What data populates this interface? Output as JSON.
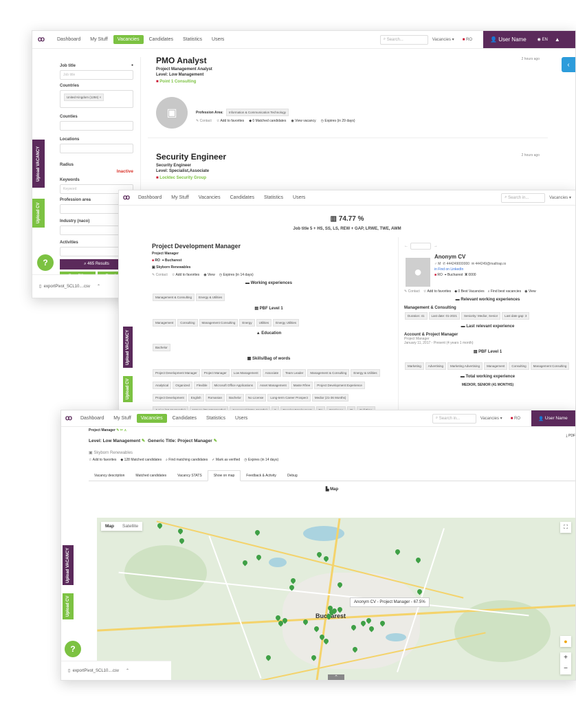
{
  "win1": {
    "nav": {
      "items": [
        "Dashboard",
        "My Stuff",
        "Vacancies",
        "Candidates",
        "Statistics",
        "Users"
      ],
      "active": "Vacancies",
      "search_placeholder": "Search...",
      "dropdown": "Vacancies",
      "lang_flag_label": "RO",
      "user": "User Name",
      "lang": "EN"
    },
    "filters": {
      "job_title_label": "Job title",
      "job_title_placeholder": "Job title",
      "countries_label": "Countries",
      "country_tag": "United Kingdom (1284)",
      "counties_label": "Counties",
      "locations_label": "Locations",
      "radius_label": "Radius",
      "radius_status": "Inactive",
      "keywords_label": "Keywords",
      "keywords_placeholder": "Keyword",
      "profession_label": "Profession area",
      "industry_label": "Industry (naco)",
      "activities_label": "Activities",
      "results_button": "465 Results",
      "save_filter": "Save Filter",
      "clear": "Deselect all"
    },
    "jobs": [
      {
        "title": "PMO Analyst",
        "subtitle": "Project Management Analyst",
        "level": "Level: Low Management",
        "company": "Point 1 Consulting",
        "time": "2 hours ago",
        "profession_label": "Profession Area:",
        "profession_value": "Information & Communication Technology",
        "actions": [
          "Contact",
          "Add to favorites",
          "0 Matched candidates",
          "View vacancy",
          "Expires (in 29 days)"
        ]
      },
      {
        "title": "Security Engineer",
        "subtitle": "Security Engineer",
        "level": "Level: Specialist,Associate",
        "company": "Locktec Security Group",
        "time": "2 hours ago"
      }
    ],
    "download": "exportPivot_SCL10....csv",
    "upload_vacancy": "Upload VACANCY",
    "upload_cv": "Upload CV"
  },
  "win2": {
    "nav": {
      "items": [
        "Dashboard",
        "My Stuff",
        "Vacancies",
        "Candidates",
        "Statistics",
        "Users"
      ],
      "search_placeholder": "Search in...",
      "dropdown": "Vacancies"
    },
    "score": "74.77 %",
    "score_subtitle": "Job title 5 + HS, SS, LS, REW + GAP, LRWE, TWE, AWM",
    "job": {
      "title": "Project Development Manager",
      "subtitle": "Project Manager",
      "country": "RO",
      "city": "Bucharest",
      "company": "Skyborn Renewables",
      "actions": [
        "Contact",
        "Add to favorites",
        "View",
        "Expires (in 14 days)"
      ],
      "working_exp_h": "Working experiences",
      "working_chips": [
        "Management & Consulting",
        "Energy & Utilities"
      ],
      "pbf_h": "PBF Level 1",
      "pbf_chips": [
        "Management",
        "Consulting",
        "Management Consulting",
        "Energy",
        "Utilities",
        "Energy Utilities"
      ],
      "education_h": "Education",
      "education_chips": [
        "Bachelor"
      ],
      "skills_h": "Skills/Bag of words",
      "skills_chips": [
        "Project Development Manager",
        "Project Manager",
        "Low Management",
        "Associate",
        "Team Leader",
        "Management & Consulting",
        "Energy & Utilities",
        "Analytical",
        "Organized",
        "Flexible",
        "Microsoft Office Applications",
        "Asset Management",
        "Maste Rfree",
        "Project Development Experience",
        "Project Development",
        "English",
        "Romanian",
        "Bachelor",
        "No License",
        "Long-term Career Prospect",
        "Medior (21-36 Months)",
        "Junior (10-24 Months)",
        "Mature (72-168 Months)",
        "Seasoned (168+ Months)",
        "3",
        "Regular Employment",
        "Ro",
        "Employee",
        "FI",
        "Full Time",
        "Internship",
        "Remote"
      ]
    },
    "cv": {
      "name": "Anonym CV",
      "gender": "M",
      "phone": "444249000000",
      "email": "444249@mailtrap.io",
      "linkedin": "Find on LinkedIn",
      "country": "RO",
      "city": "Bucharest",
      "code": "0000",
      "actions": [
        "Contact",
        "Add to favorites",
        "0 Best Vacancies",
        "Find best vacancies",
        "View"
      ],
      "relevant_h": "Relevant working experiences",
      "exp_title": "Management & Consulting",
      "exp_stats": [
        "Duration: 41",
        "Last date: 01-2021",
        "Seniority: Medior, Senior",
        "Last date gap: 3"
      ],
      "last_h": "Last relevant experience",
      "last_title": "Account & Project Manager",
      "last_sub": "Project Manager",
      "last_dates": "January 11, 2017 - Present (4 years 1 month)",
      "pbf_h": "PBF Level 1",
      "pbf_chips": [
        "Marketing",
        "Advertising",
        "Marketing Advertising",
        "Management",
        "Consulting",
        "Management Consulting"
      ],
      "total_h": "Total working experience",
      "total_value": "MEDIOR, SENIOR (41 MONTHS)"
    },
    "upload_vacancy": "Upload VACANCY",
    "upload_cv": "Upload CV"
  },
  "win3": {
    "nav": {
      "items": [
        "Dashboard",
        "My Stuff",
        "Vacancies",
        "Candidates",
        "Statistics",
        "Users"
      ],
      "active": "Vacancies",
      "search_placeholder": "Search in...",
      "dropdown": "Vacancies",
      "lang_flag_label": "RO",
      "user": "User Name"
    },
    "header_partial": "Project Manager",
    "level": "Level: Low Management",
    "generic_title": "Generic Title: Project Manager",
    "pdf": "PDF",
    "company": "Skyborn Renewables",
    "actions": [
      "Add to favorites",
      "128 Matched candidates",
      "Find matching candidates",
      "Mark as verified",
      "Expires (in 14 days)"
    ],
    "tabs": [
      "Vacancy description",
      "Matched candidates",
      "Vacancy STATS",
      "Show on map",
      "Feedback & Activity",
      "Debug"
    ],
    "active_tab": "Show on map",
    "map_title": "Map",
    "map_toggle": [
      "Map",
      "Satellite"
    ],
    "city": "Bucharest",
    "tooltip": "Anonym CV - Project Manager - 67.5%",
    "download": "exportPivot_SCL10....csv",
    "upload_vacancy": "Upload VACANCY",
    "upload_cv": "Upload CV"
  },
  "help": "?",
  "colors": {
    "primary": "#5b2a5b",
    "accent": "#7cc242"
  }
}
